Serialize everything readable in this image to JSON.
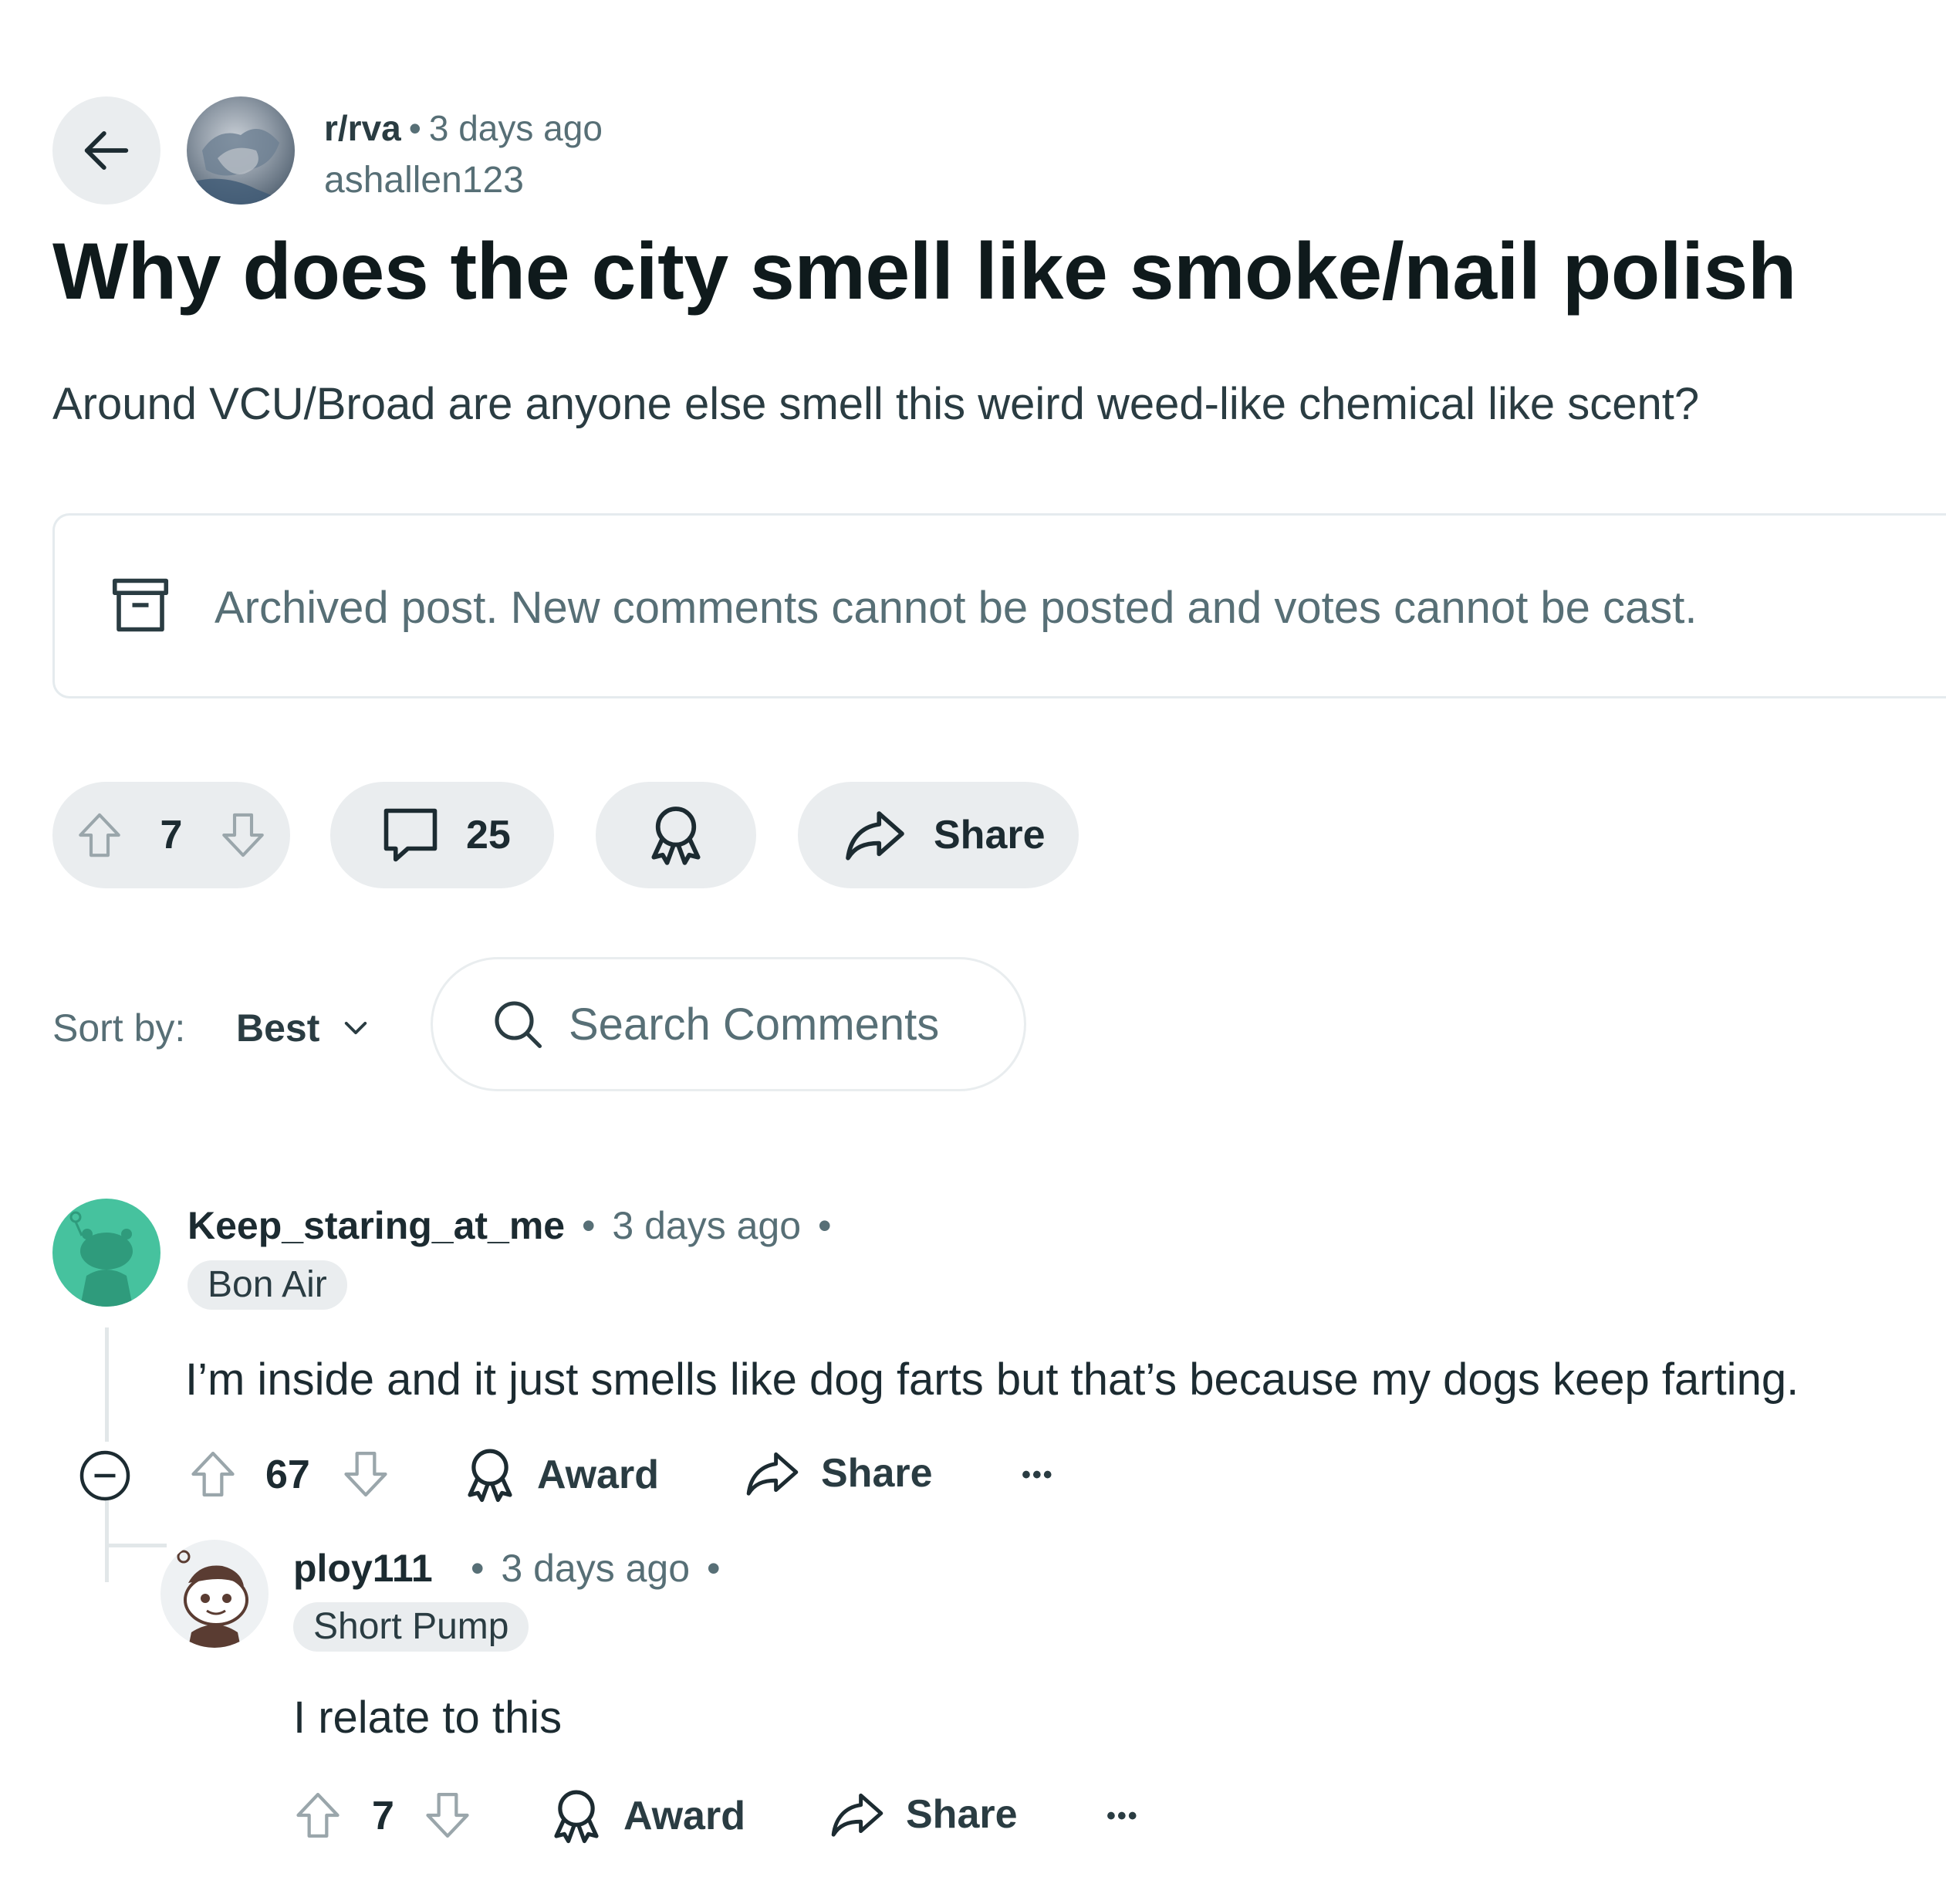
{
  "post": {
    "subreddit": "r/rva",
    "separator": "•",
    "time": "3 days ago",
    "author": "ashallen123",
    "title": "Why does the city smell like smoke/nail polish",
    "body": "Around VCU/Broad are anyone else smell this weird weed-like chemical like scent?",
    "archived_notice": "Archived post. New comments cannot be posted and votes cannot be cast.",
    "vote_count": "7",
    "comment_count": "25",
    "share_label": "Share"
  },
  "sort": {
    "label": "Sort by:",
    "value": "Best"
  },
  "search": {
    "placeholder": "Search Comments"
  },
  "comments": [
    {
      "author": "Keep_staring_at_me",
      "time": "3 days ago",
      "flair": "Bon Air",
      "body": "I’m inside and it just smells like dog farts but that’s because my dogs keep farting.",
      "votes": "67",
      "award_label": "Award",
      "share_label": "Share",
      "more_label": "•••",
      "avatar_color": "#46c29e",
      "replies": [
        {
          "author": "ploy111",
          "time": "3 days ago",
          "flair": "Short Pump",
          "body": "I relate to this",
          "votes": "7",
          "award_label": "Award",
          "share_label": "Share",
          "more_label": "•••"
        }
      ]
    }
  ],
  "icons": {
    "back": "arrow-left-icon",
    "archive": "archive-box-icon",
    "upvote": "arrow-up-outline-icon",
    "downvote": "arrow-down-outline-icon",
    "comment": "speech-bubble-icon",
    "award": "award-ribbon-icon",
    "share": "share-arrow-icon",
    "search": "magnifier-icon",
    "chevron": "chevron-down-icon",
    "collapse": "minus-circle-icon"
  },
  "colors": {
    "pill_bg": "#eaedef",
    "meta_text": "#576f76",
    "title_text": "#0f1a1c"
  }
}
